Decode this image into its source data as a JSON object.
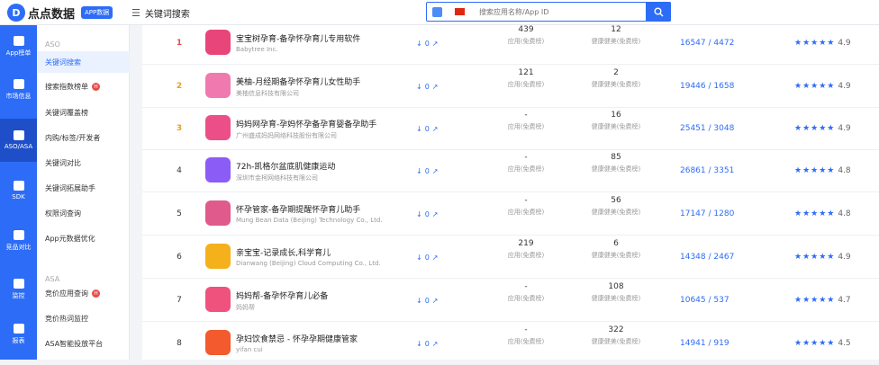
{
  "topbar": {
    "logo_mark": "D",
    "logo_text": "点点数据",
    "logo_badge": "APP数据",
    "crumb": "关键词搜索",
    "search_placeholder": "搜索应用名称/App ID"
  },
  "leftnav": [
    {
      "label": "App榜单",
      "icon": "app-chart-icon"
    },
    {
      "label": "市场信息",
      "icon": "market-icon"
    },
    {
      "label": "ASO/ASA",
      "icon": "rocket-icon"
    },
    {
      "label": "SDK",
      "icon": "sdk-layers-icon"
    },
    {
      "label": "竞品对比",
      "icon": "compare-icon"
    },
    {
      "label": "监控",
      "icon": "monitor-icon"
    },
    {
      "label": "报表",
      "icon": "report-icon"
    }
  ],
  "submenu": {
    "head_aso": "ASO",
    "head_asa": "ASA",
    "items": [
      {
        "label": "关键词搜索",
        "hot": false
      },
      {
        "label": "搜索指数榜单",
        "hot": true
      },
      {
        "label": "关键词覆盖榜",
        "hot": false
      },
      {
        "label": "内购/标签/开发者",
        "hot": false
      },
      {
        "label": "关键词对比",
        "hot": false
      },
      {
        "label": "关键词拓展助手",
        "hot": false
      },
      {
        "label": "权限词查询",
        "hot": false
      },
      {
        "label": "App元数据优化",
        "hot": false
      },
      {
        "label": "竞价应用查询",
        "hot": true
      },
      {
        "label": "竞价热词监控",
        "hot": false
      },
      {
        "label": "ASA智能投放平台",
        "hot": false
      }
    ]
  },
  "rows": [
    {
      "rank": "1",
      "name": "宝宝树孕育-备孕怀孕育儿专用软件",
      "dev": "Babytree Inc.",
      "icon_color": "#e8457a",
      "dl": "0",
      "m1v": "439",
      "m1l": "应用(免费榜)",
      "m2v": "12",
      "m2l": "健康健美(免费榜)",
      "kw": "16547 / 4472",
      "stars": "★★★★★",
      "score": "4.9"
    },
    {
      "rank": "2",
      "name": "美柚-月经期备孕怀孕育儿女性助手",
      "dev": "美柚信息科技有限公司",
      "icon_color": "#f07ab0",
      "dl": "0",
      "m1v": "121",
      "m1l": "应用(免费榜)",
      "m2v": "2",
      "m2l": "健康健美(免费榜)",
      "kw": "19446 / 1658",
      "stars": "★★★★★",
      "score": "4.9"
    },
    {
      "rank": "3",
      "name": "妈妈网孕育-孕妈怀孕备孕育婴备孕助手",
      "dev": "广州盛成妈妈网络科技股份有限公司",
      "icon_color": "#ec4f88",
      "dl": "0",
      "m1v": "-",
      "m1l": "应用(免费榜)",
      "m2v": "16",
      "m2l": "健康健美(免费榜)",
      "kw": "25451 / 3048",
      "stars": "★★★★★",
      "score": "4.9"
    },
    {
      "rank": "4",
      "name": "72h-凯格尔盆底肌健康运动",
      "dev": "深圳市金柯网络科技有限公司",
      "icon_color": "#8b5cf6",
      "dl": "0",
      "m1v": "-",
      "m1l": "应用(免费榜)",
      "m2v": "85",
      "m2l": "健康健美(免费榜)",
      "kw": "26861 / 3351",
      "stars": "★★★★★",
      "score": "4.8"
    },
    {
      "rank": "5",
      "name": "怀孕管家-备孕期提醒怀孕育儿助手",
      "dev": "Mung Bean Data (Beijing) Technology Co., Ltd.",
      "icon_color": "#e05a8c",
      "dl": "0",
      "m1v": "-",
      "m1l": "应用(免费榜)",
      "m2v": "56",
      "m2l": "健康健美(免费榜)",
      "kw": "17147 / 1280",
      "stars": "★★★★★",
      "score": "4.8"
    },
    {
      "rank": "6",
      "name": "亲宝宝-记录成长,科学育儿",
      "dev": "Dianwang (Beijing) Cloud Computing Co., Ltd.",
      "icon_color": "#f5b11c",
      "dl": "0",
      "m1v": "219",
      "m1l": "应用(免费榜)",
      "m2v": "6",
      "m2l": "健康健美(免费榜)",
      "kw": "14348 / 2467",
      "stars": "★★★★★",
      "score": "4.9"
    },
    {
      "rank": "7",
      "name": "妈妈帮-备孕怀孕育儿必备",
      "dev": "妈妈帮",
      "icon_color": "#f0527e",
      "dl": "0",
      "m1v": "-",
      "m1l": "应用(免费榜)",
      "m2v": "108",
      "m2l": "健康健美(免费榜)",
      "kw": "10645 / 537",
      "stars": "★★★★★",
      "score": "4.7"
    },
    {
      "rank": "8",
      "name": "孕妇饮食禁忌 - 怀孕孕期健康管家",
      "dev": "yifan cui",
      "icon_color": "#f35a2d",
      "dl": "0",
      "m1v": "-",
      "m1l": "应用(免费榜)",
      "m2v": "322",
      "m2l": "健康健美(免费榜)",
      "kw": "14941 / 919",
      "stars": "★★★★★",
      "score": "4.5"
    }
  ]
}
